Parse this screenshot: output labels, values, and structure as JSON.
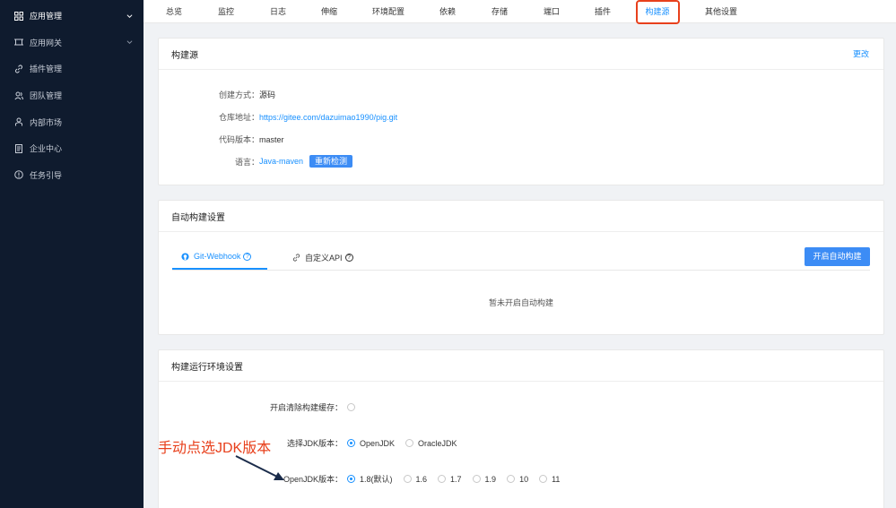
{
  "sidebar": {
    "items": [
      {
        "label": "应用管理",
        "icon": "grid-icon"
      },
      {
        "label": "应用网关",
        "icon": "gateway-icon"
      },
      {
        "label": "插件管理",
        "icon": "link-icon"
      },
      {
        "label": "团队管理",
        "icon": "team-icon"
      },
      {
        "label": "内部市场",
        "icon": "market-icon"
      },
      {
        "label": "企业中心",
        "icon": "document-icon"
      },
      {
        "label": "任务引导",
        "icon": "info-icon"
      }
    ]
  },
  "tabs": [
    "总览",
    "监控",
    "日志",
    "伸缩",
    "环境配置",
    "依赖",
    "存储",
    "端口",
    "插件",
    "构建源",
    "其他设置"
  ],
  "active_tab": "构建源",
  "build_source": {
    "title": "构建源",
    "edit_link": "更改",
    "method_label": "创建方式：",
    "method_value": "源码",
    "repo_label": "仓库地址：",
    "repo_value": "https://gitee.com/dazuimao1990/pig.git",
    "version_label": "代码版本：",
    "version_value": "master",
    "lang_label": "语言：",
    "lang_value": "Java-maven",
    "recheck_button": "重新检测"
  },
  "auto_build": {
    "title": "自动构建设置",
    "tab_webhook": "Git-Webhook",
    "tab_api": "自定义API",
    "enable_button": "开启自动构建",
    "empty_text": "暂未开启自动构建"
  },
  "runtime": {
    "title": "构建运行环境设置",
    "clear_cache_label": "开启清除构建缓存：",
    "jdk_label": "选择JDK版本：",
    "jdk_options": [
      "OpenJDK",
      "OracleJDK"
    ],
    "openjdk_label": "OpenJDK版本：",
    "openjdk_options": [
      "1.8(默认)",
      "1.6",
      "1.7",
      "1.9",
      "10",
      "11"
    ]
  },
  "annotation": "手动点选JDK版本",
  "colors": {
    "accent": "#1890ff",
    "sidebar": "#0f1b2e",
    "annotation": "#e8401c"
  }
}
